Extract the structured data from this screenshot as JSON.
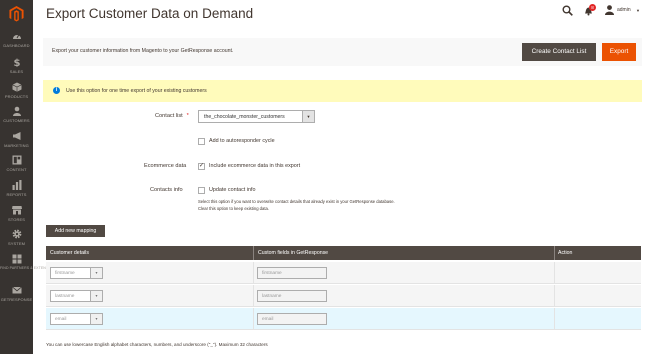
{
  "header": {
    "title": "Export Customer Data on Demand",
    "notifications_count": "8",
    "user": "admin"
  },
  "sidebar": {
    "items": [
      {
        "label": "DASHBOARD",
        "icon": "dashboard-icon"
      },
      {
        "label": "SALES",
        "icon": "dollar-icon"
      },
      {
        "label": "PRODUCTS",
        "icon": "box-icon"
      },
      {
        "label": "CUSTOMERS",
        "icon": "person-icon"
      },
      {
        "label": "MARKETING",
        "icon": "megaphone-icon"
      },
      {
        "label": "CONTENT",
        "icon": "layout-icon"
      },
      {
        "label": "REPORTS",
        "icon": "bar-chart-icon"
      },
      {
        "label": "STORES",
        "icon": "store-icon"
      },
      {
        "label": "SYSTEM",
        "icon": "gear-icon"
      },
      {
        "label": "FIND PARTNERS & EXTENSIONS",
        "icon": "blocks-icon"
      },
      {
        "label": "GETRESPONSE",
        "icon": "envelope-icon"
      }
    ]
  },
  "action_bar": {
    "text": "Export your customer information from Magento to your GetResponse account.",
    "create_contact_list": "Create Contact List",
    "export": "Export"
  },
  "info": {
    "text": "Use this option for one time export of your existing customers"
  },
  "form": {
    "contact_list_label": "Contact list",
    "required_mark": "*",
    "contact_list_value": "the_chocolate_monster_customers",
    "autoresponder_label": "Add to autoresponder cycle",
    "autoresponder_checked": false,
    "ecommerce_label": "Ecommerce data",
    "ecommerce_option": "Include ecommerce data in this export",
    "ecommerce_checked": true,
    "contacts_info_label": "Contacts info",
    "update_contact_label": "Update contact info",
    "update_contact_checked": false,
    "note_line1": "Select this option if you want to overwrite contact details that already exist in your GetResponse database.",
    "note_line2": "Clear this option to keep existing data."
  },
  "mapping": {
    "add_button": "Add new mapping",
    "columns": [
      "Customer details",
      "Custom fields in GetResponse",
      "Action"
    ],
    "rows": [
      {
        "customer_detail": "firstname",
        "custom_field": "firstname"
      },
      {
        "customer_detail": "lastname",
        "custom_field": "lastname"
      },
      {
        "customer_detail": "email",
        "custom_field": "email"
      }
    ]
  },
  "footnote": "You can use lowercase English alphabet characters, numbers, and underscore (\"_\"). Maximum 32 characters",
  "colors": {
    "sidebar": "#373330",
    "primary_button": "#eb5202",
    "dark_button": "#514943",
    "info_bg": "#fffbbb",
    "badge": "#e22626"
  }
}
